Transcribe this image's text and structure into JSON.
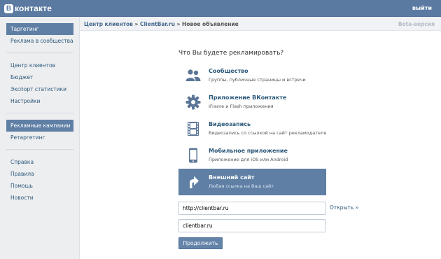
{
  "header": {
    "logo_letter": "В",
    "logo_text": "контакте",
    "logout_label": "выйти"
  },
  "sidebar": {
    "group1": [
      "Таргетинг",
      "Реклама в сообществах"
    ],
    "group2": [
      "Центр клиентов",
      "Бюджет",
      "Экспорт статистики",
      "Настройки"
    ],
    "group3": [
      "Рекламные кампании",
      "Ретаргетинг"
    ],
    "group4": [
      "Справка",
      "Правила",
      "Помощь",
      "Новости"
    ]
  },
  "breadcrumb": {
    "part1": "Центр клиентов",
    "sep1": " » ",
    "part2": "ClientBar.ru",
    "sep2": " » ",
    "current": "Новое объявление"
  },
  "beta_label": "Beta-версия",
  "question": "Что Вы будете рекламировать?",
  "options": [
    {
      "title": "Сообщество",
      "desc": "Группы, публичные страницы и встречи",
      "icon": "users-icon"
    },
    {
      "title": "Приложение ВКонтакте",
      "desc": "IFrame и Flash приложения",
      "icon": "gear-icon"
    },
    {
      "title": "Видеозапись",
      "desc": "Видеозапись со ссылкой на сайт рекламодателя",
      "icon": "film-icon"
    },
    {
      "title": "Мобильное приложение",
      "desc": "Приложение для iOS или Android",
      "icon": "phone-icon"
    },
    {
      "title": "Внешний сайт",
      "desc": "Любая ссылка на Ваш сайт",
      "icon": "arrow-icon",
      "selected": true
    }
  ],
  "url_input": {
    "value": "http://clientbar.ru"
  },
  "open_link": "Открыть »",
  "domain_input": {
    "value": "clientbar.ru"
  },
  "continue_button": "Продолжить",
  "colors": {
    "header": "#5a7aa2",
    "selected": "#5f7fa5",
    "link": "#2b587a"
  }
}
